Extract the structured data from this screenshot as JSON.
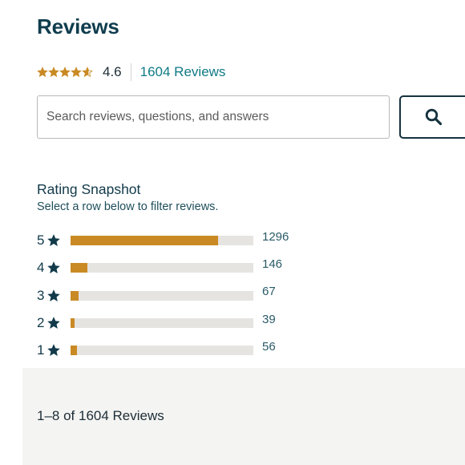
{
  "header": {
    "title": "Reviews"
  },
  "summary": {
    "average": "4.6",
    "average_value": 4.6,
    "max_stars": 5,
    "review_link": "1604 Reviews",
    "star_color": "#c98a24"
  },
  "search": {
    "placeholder": "Search reviews, questions, and answers",
    "value": "",
    "button_icon": "search-icon"
  },
  "snapshot": {
    "title": "Rating Snapshot",
    "subtitle": "Select a row below to filter reviews.",
    "rows": [
      {
        "stars": "5",
        "count": "1296",
        "fraction": 0.808
      },
      {
        "stars": "4",
        "count": "146",
        "fraction": 0.091
      },
      {
        "stars": "3",
        "count": "67",
        "fraction": 0.042
      },
      {
        "stars": "2",
        "count": "39",
        "fraction": 0.024
      },
      {
        "stars": "1",
        "count": "56",
        "fraction": 0.035
      }
    ],
    "bar_color": "#c98a24",
    "track_color": "#e6e4e1"
  },
  "results": {
    "count_text": "1–8 of 1604 Reviews"
  }
}
